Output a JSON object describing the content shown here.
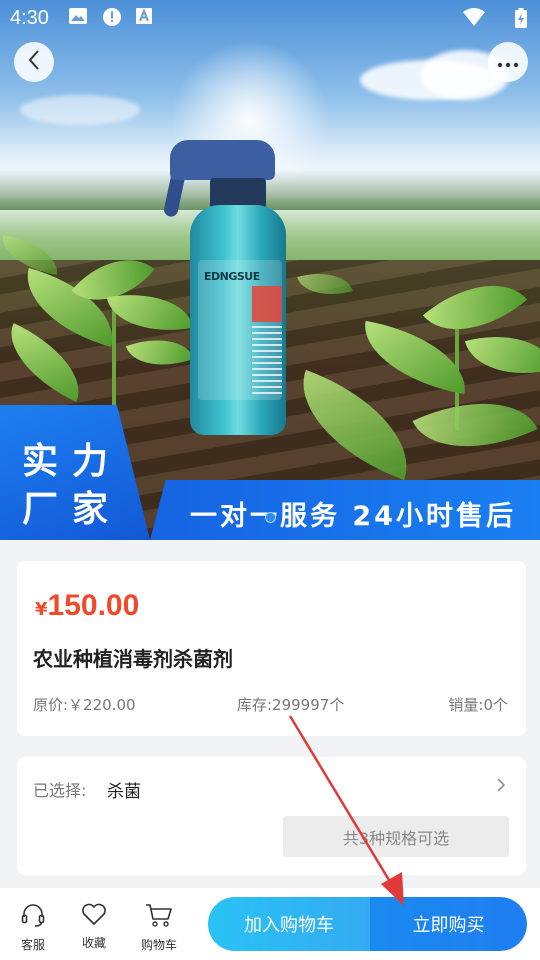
{
  "status_bar": {
    "time": "4:30",
    "icons": [
      "image-icon",
      "alert-icon",
      "text-a-icon",
      "wifi-icon",
      "battery-icon"
    ]
  },
  "nav": {
    "back_icon": "chevron-left-icon",
    "more_icon": "more-icon"
  },
  "banner": {
    "big_text_line1": "实力",
    "big_text_line2": "厂家",
    "slogan": "一对一服务 24小时售后",
    "bottle_label": "EDNGSUE",
    "carousel_active_index": 0,
    "accent_color": "#1a6fe8"
  },
  "product": {
    "currency": "¥",
    "price": "150.00",
    "title": "农业种植消毒剂杀菌剂",
    "original_price": "原价:￥220.00",
    "stock": "库存:299997个",
    "sales": "销量:0个",
    "price_color": "#f04a2a"
  },
  "spec": {
    "label": "已选择:",
    "value": "杀菌",
    "options_text": "共3种规格可选"
  },
  "bottom_bar": {
    "service_label": "客服",
    "favorite_label": "收藏",
    "cart_label": "购物车",
    "add_to_cart": "加入购物车",
    "buy_now": "立即购买"
  }
}
